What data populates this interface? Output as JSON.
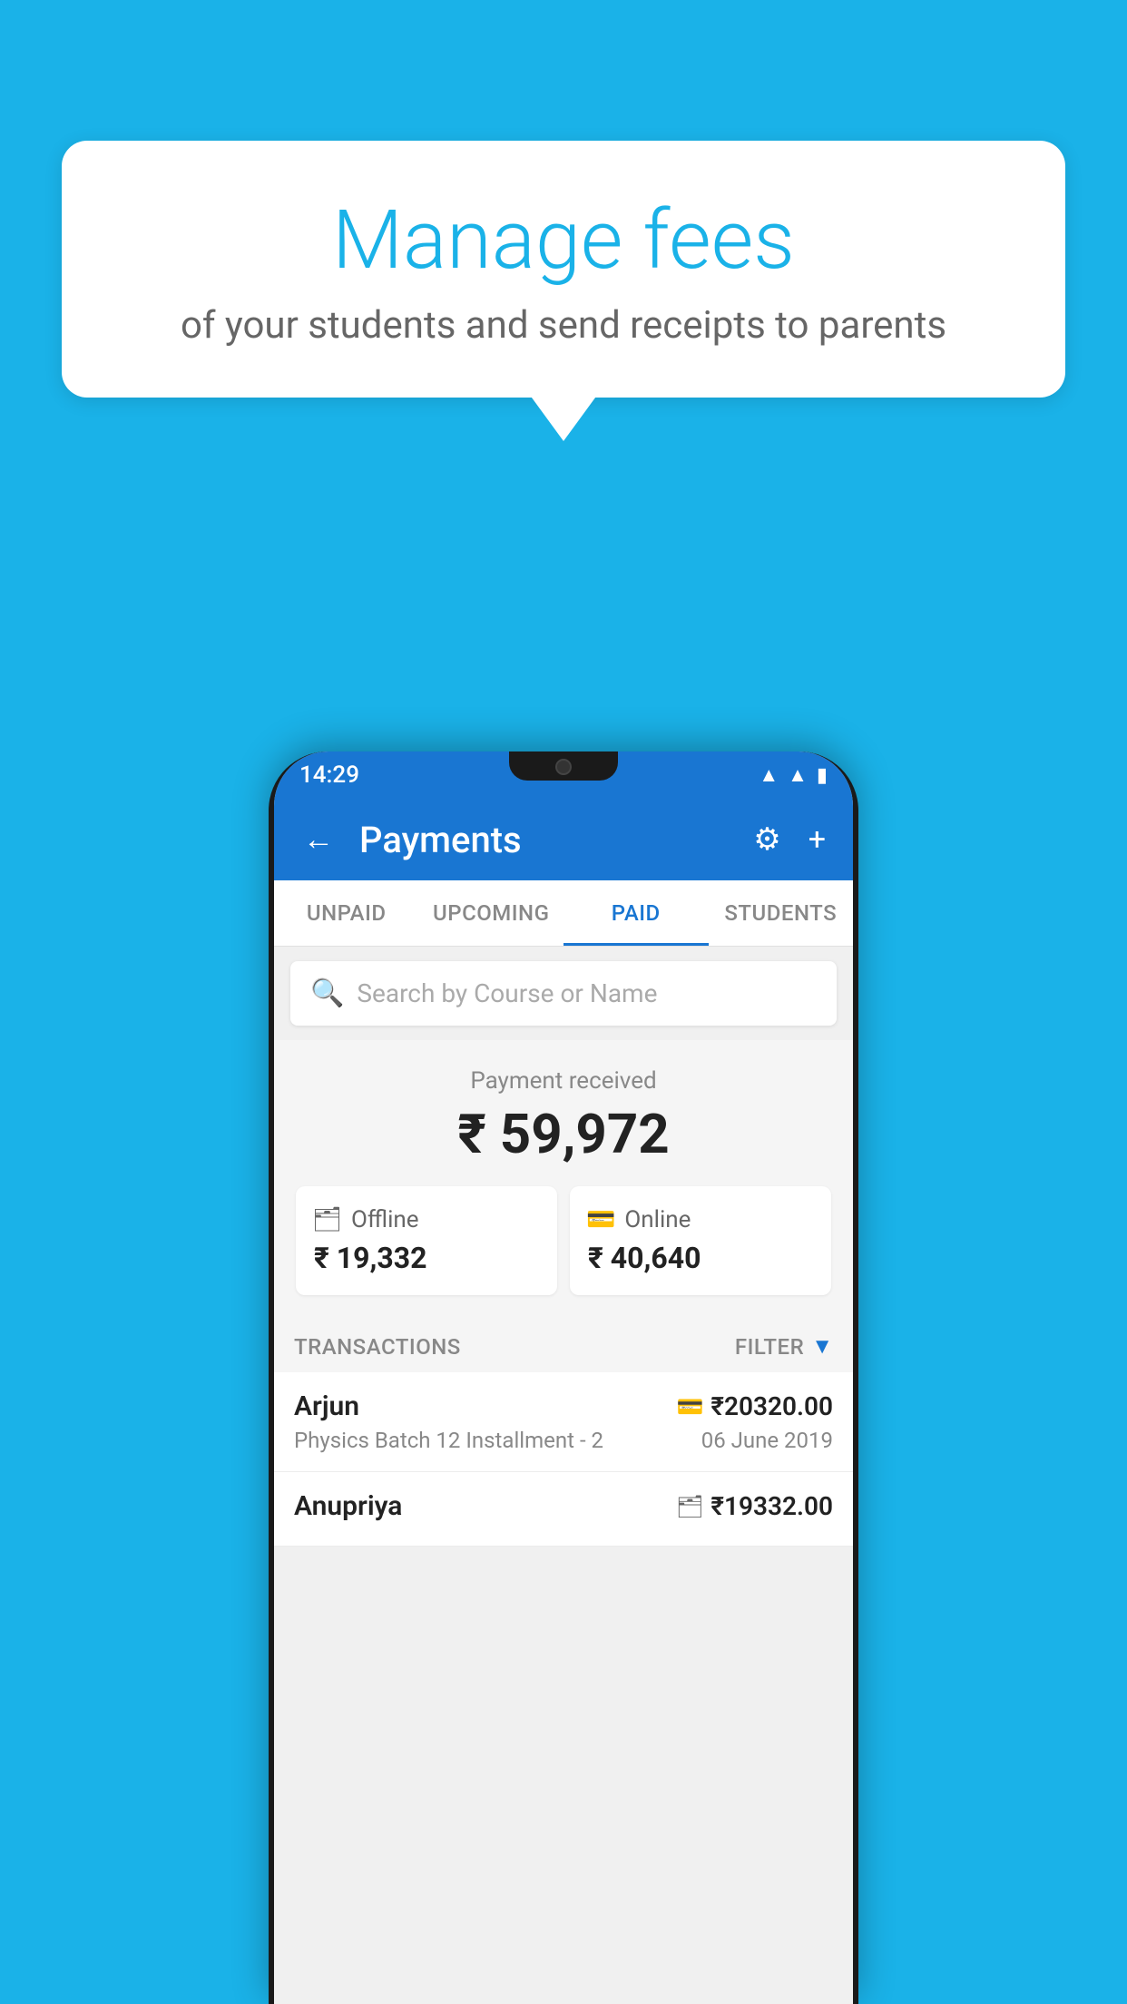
{
  "background_color": "#1ab2e8",
  "bubble": {
    "title": "Manage fees",
    "subtitle": "of your students and send receipts to parents"
  },
  "phone": {
    "status_bar": {
      "time": "14:29",
      "icons": [
        "wifi",
        "signal",
        "battery"
      ]
    },
    "app_bar": {
      "title": "Payments",
      "back_icon": "←",
      "settings_icon": "⚙",
      "add_icon": "+"
    },
    "tabs": [
      {
        "label": "UNPAID",
        "active": false
      },
      {
        "label": "UPCOMING",
        "active": false
      },
      {
        "label": "PAID",
        "active": true
      },
      {
        "label": "STUDENTS",
        "active": false
      }
    ],
    "search": {
      "placeholder": "Search by Course or Name"
    },
    "payment_summary": {
      "label": "Payment received",
      "amount": "₹ 59,972",
      "breakdown": [
        {
          "type": "Offline",
          "icon": "offline",
          "amount": "₹ 19,332"
        },
        {
          "type": "Online",
          "icon": "online",
          "amount": "₹ 40,640"
        }
      ]
    },
    "transactions": {
      "section_label": "TRANSACTIONS",
      "filter_label": "FILTER",
      "items": [
        {
          "name": "Arjun",
          "course": "Physics Batch 12 Installment - 2",
          "amount": "₹20320.00",
          "date": "06 June 2019",
          "payment_type": "online"
        },
        {
          "name": "Anupriya",
          "course": "",
          "amount": "₹19332.00",
          "date": "",
          "payment_type": "offline"
        }
      ]
    }
  }
}
